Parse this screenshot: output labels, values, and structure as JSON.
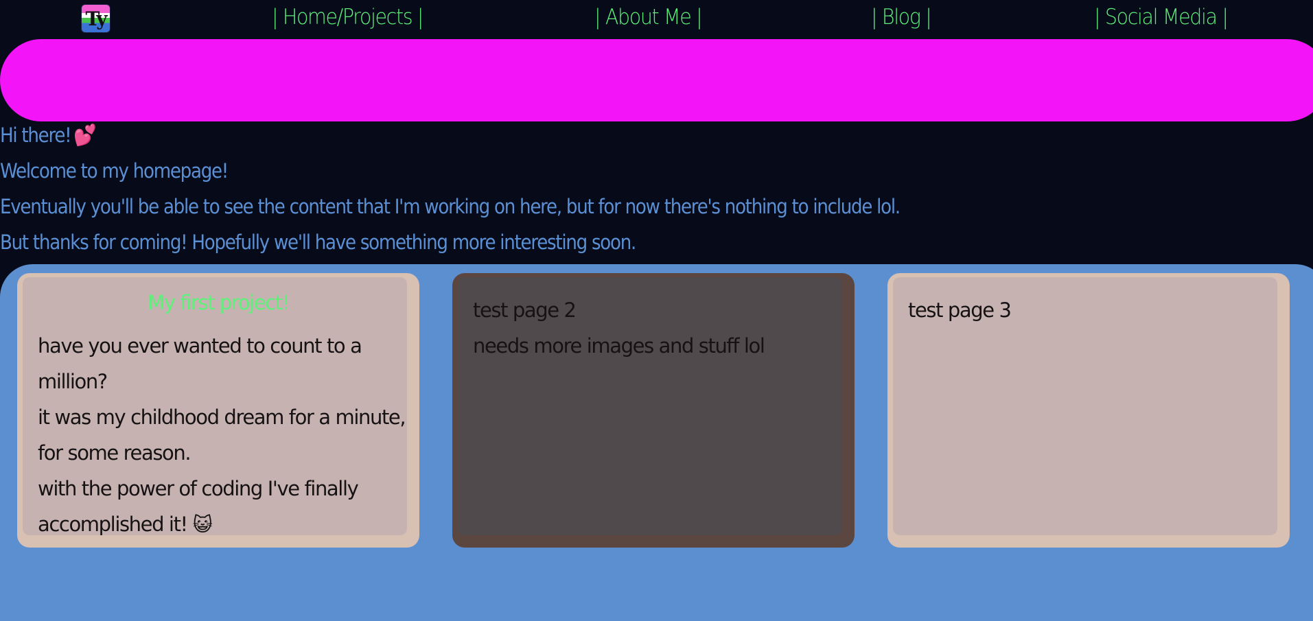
{
  "nav": {
    "logo_text": "Ty",
    "links": [
      {
        "label": "| Home/Projects |"
      },
      {
        "label": "| About Me |"
      },
      {
        "label": "| Blog |"
      },
      {
        "label": "| Social Media |"
      }
    ]
  },
  "intro": {
    "greeting": "Hi there!",
    "greeting_emoji": "💕",
    "line1": "Welcome to my homepage!",
    "line2": "Eventually you'll be able to see the content that I'm working on here, but for now there's nothing to include lol.",
    "line3": "But thanks for coming! Hopefully we'll have something more interesting soon."
  },
  "cards": [
    {
      "title": "My first project!",
      "lines": [
        "have you ever wanted to count to a million?",
        "it was my childhood dream for a minute, for some reason.",
        "with the power of coding I've finally accomplished it!"
      ],
      "emoji": "😺"
    },
    {
      "lines": [
        "test page 2",
        "needs more images and stuff lol"
      ]
    },
    {
      "lines": [
        "test page 3"
      ]
    }
  ],
  "colors": {
    "background": "#070a19",
    "nav_link": "#5ef07a",
    "banner": "#f414f8",
    "intro_text": "#5b90d4",
    "panel": "#5b8fd0",
    "card_light": "#c6b3b1",
    "card_dark": "#514a4c"
  }
}
